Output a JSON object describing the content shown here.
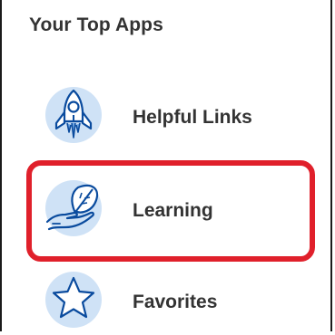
{
  "section": {
    "title": "Your Top Apps"
  },
  "apps": [
    {
      "label": "Helpful Links",
      "icon": "rocket-icon"
    },
    {
      "label": "Learning",
      "icon": "hand-leaf-icon"
    },
    {
      "label": "Favorites",
      "icon": "star-icon"
    }
  ],
  "colors": {
    "icon_bg": "#cfe2f6",
    "icon_stroke": "#0a4b9e",
    "highlight": "#e0202b",
    "text": "#333333"
  }
}
